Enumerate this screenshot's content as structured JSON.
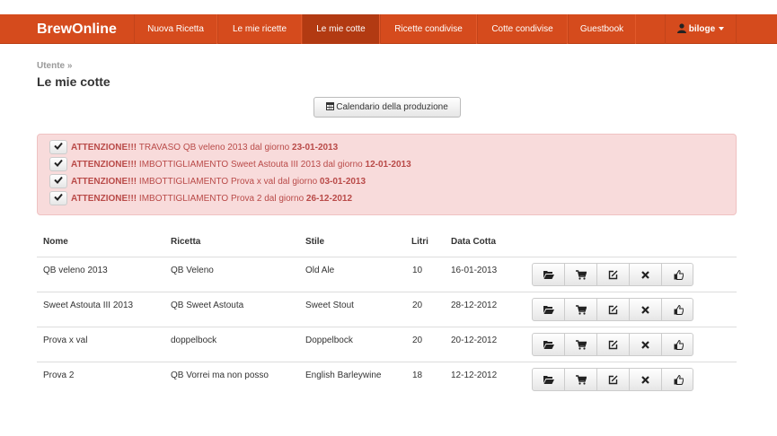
{
  "navbar": {
    "brand": "BrewOnline",
    "items": [
      {
        "label": "Nuova Ricetta"
      },
      {
        "label": "Le mie ricette"
      },
      {
        "label": "Le mie cotte"
      },
      {
        "label": "Ricette condivise"
      },
      {
        "label": "Cotte condivise"
      },
      {
        "label": "Guestbook"
      }
    ],
    "user": "biloge",
    "color": "#d54b1d"
  },
  "breadcrumb": "Utente »",
  "page_title": "Le mie cotte",
  "calendar_button": "Calendario della produzione",
  "alerts": [
    {
      "prefix": "ATTENZIONE!!!",
      "text": " TRAVASO QB veleno 2013 dal giorno ",
      "date": "23-01-2013"
    },
    {
      "prefix": "ATTENZIONE!!!",
      "text": " IMBOTTIGLIAMENTO Sweet Astouta III 2013 dal giorno ",
      "date": "12-01-2013"
    },
    {
      "prefix": "ATTENZIONE!!!",
      "text": " IMBOTTIGLIAMENTO Prova x val dal giorno ",
      "date": "03-01-2013"
    },
    {
      "prefix": "ATTENZIONE!!!",
      "text": " IMBOTTIGLIAMENTO Prova 2 dal giorno ",
      "date": "26-12-2012"
    }
  ],
  "table": {
    "headers": [
      "Nome",
      "Ricetta",
      "Stile",
      "Litri",
      "Data Cotta"
    ],
    "rows": [
      {
        "nome": "QB veleno 2013",
        "ricetta": "QB Veleno",
        "stile": "Old Ale",
        "litri": "10",
        "data": "16-01-2013"
      },
      {
        "nome": "Sweet Astouta III 2013",
        "ricetta": "QB Sweet Astouta",
        "stile": "Sweet Stout",
        "litri": "20",
        "data": "28-12-2012"
      },
      {
        "nome": "Prova x val",
        "ricetta": "doppelbock",
        "stile": "Doppelbock",
        "litri": "20",
        "data": "20-12-2012"
      },
      {
        "nome": "Prova 2",
        "ricetta": "QB Vorrei ma non posso",
        "stile": "English Barleywine",
        "litri": "18",
        "data": "12-12-2012"
      }
    ],
    "actions": [
      "folder-open-icon",
      "shopping-cart-icon",
      "edit-icon",
      "delete-icon",
      "thumbs-up-icon"
    ]
  }
}
